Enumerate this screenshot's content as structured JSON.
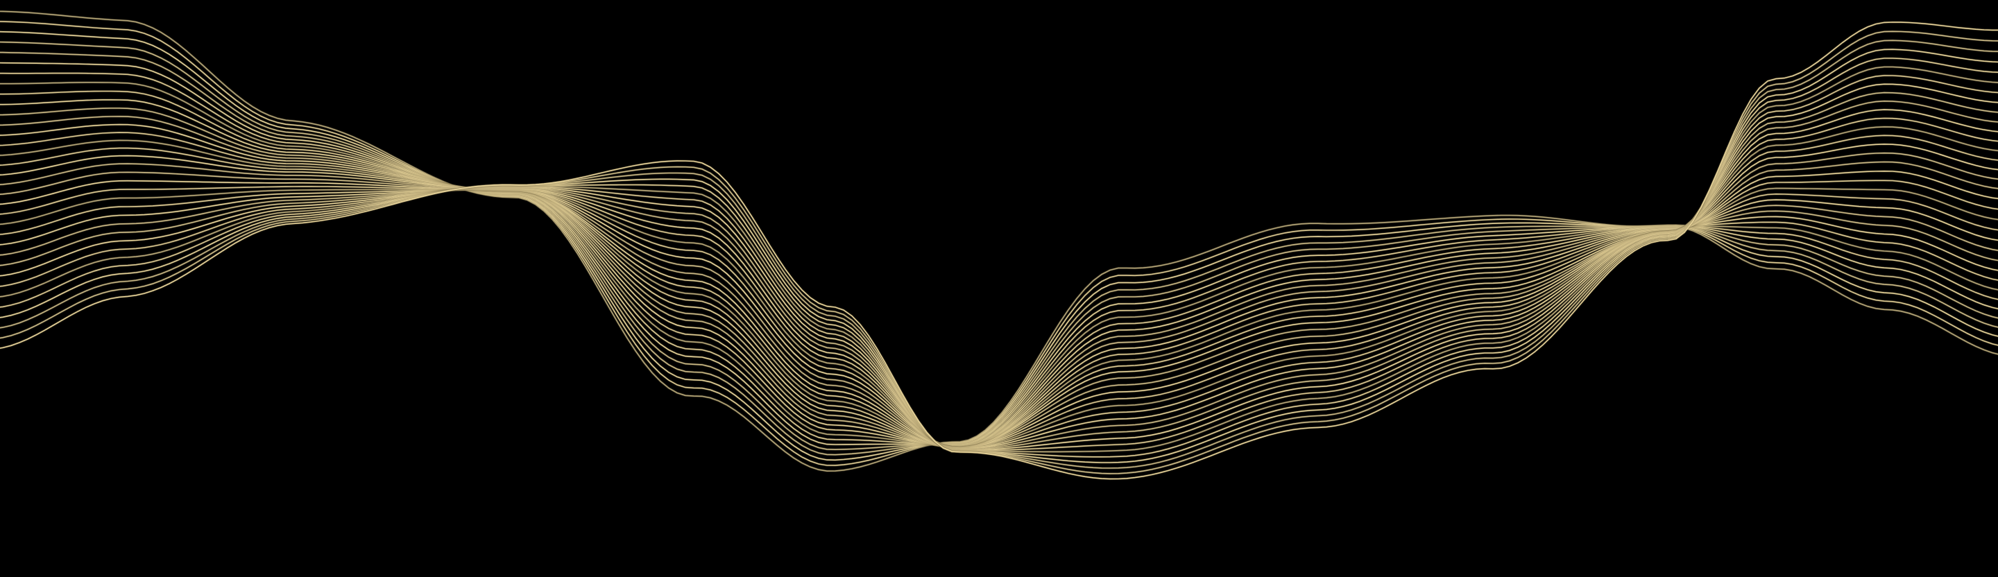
{
  "image": {
    "background_color": "#000000",
    "line_color": "#E8D49A",
    "line_shadow_color": "#8A7A52",
    "strand_count": 34
  }
}
